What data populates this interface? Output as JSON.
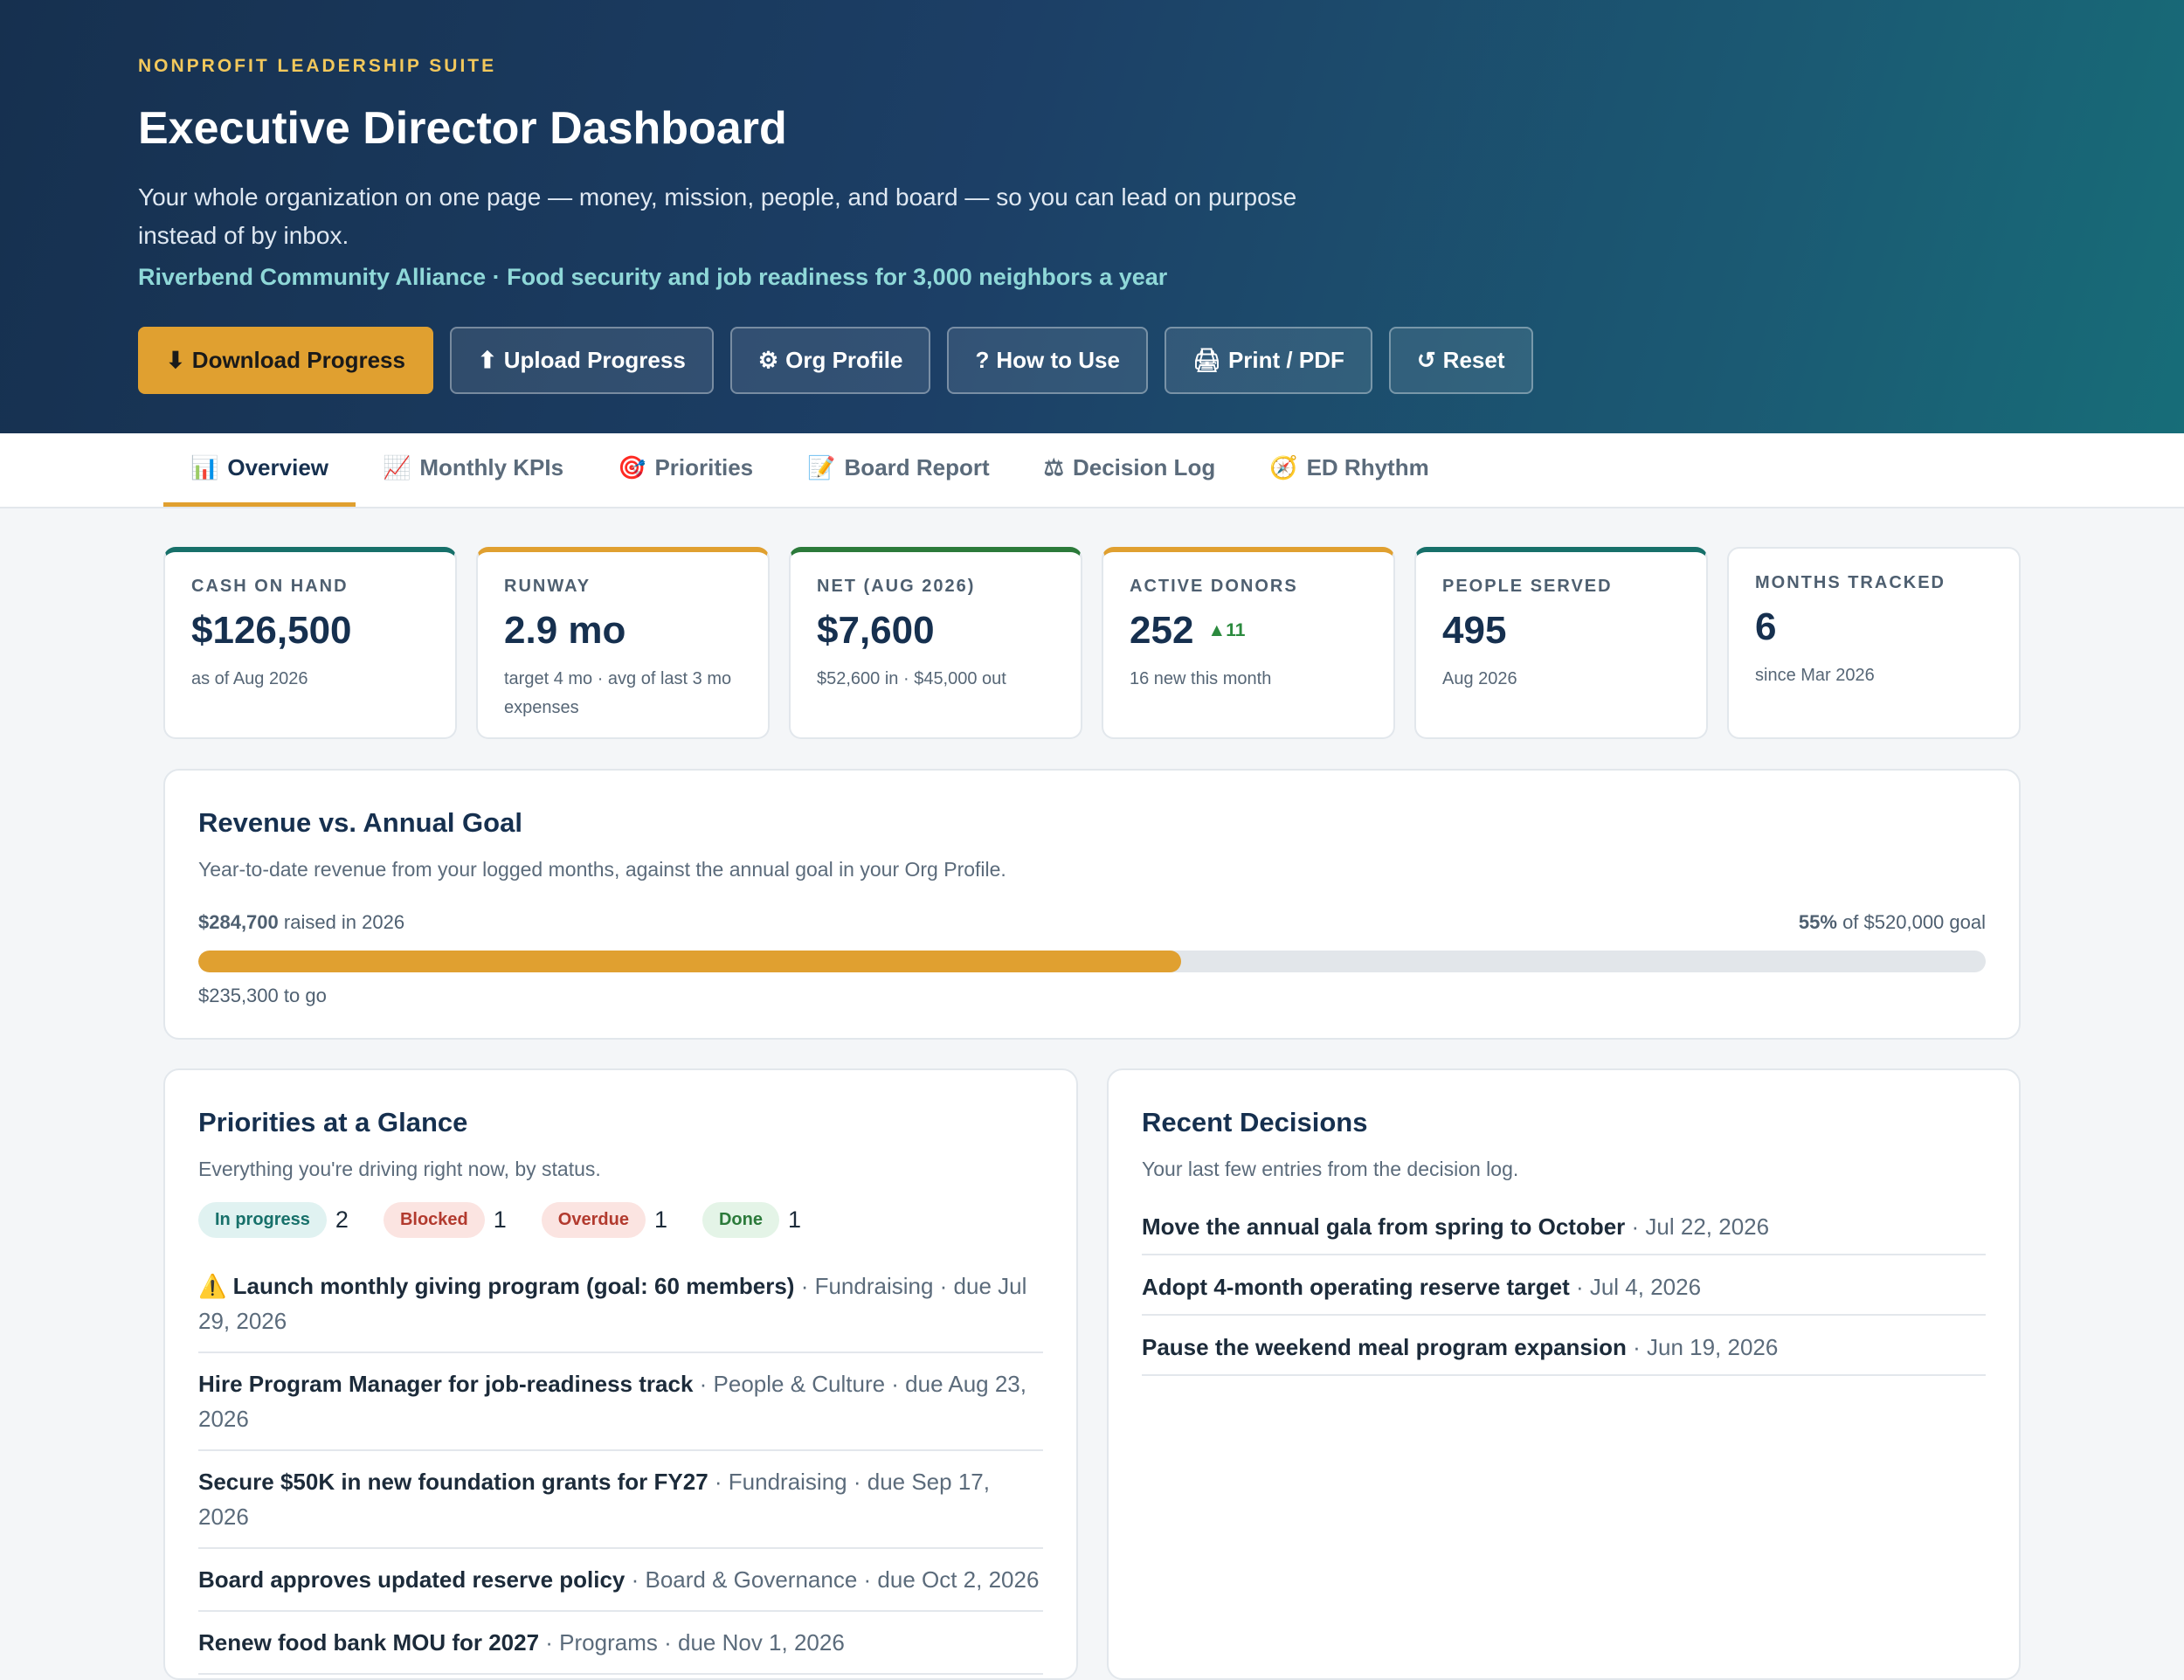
{
  "header": {
    "eyebrow": "NONPROFIT LEADERSHIP SUITE",
    "title": "Executive Director Dashboard",
    "lede": "Your whole organization on one page — money, mission, people, and board — so you can lead on purpose instead of by inbox.",
    "org_line": "Riverbend Community Alliance · Food security and job readiness for 3,000 neighbors a year",
    "buttons": [
      {
        "icon": "⬇",
        "label": "Download Progress"
      },
      {
        "icon": "⬆",
        "label": "Upload Progress"
      },
      {
        "icon": "⚙",
        "label": "Org Profile"
      },
      {
        "icon": "?",
        "label": "How to Use"
      },
      {
        "icon": "🖨",
        "label": "Print / PDF"
      },
      {
        "icon": "↺",
        "label": "Reset"
      }
    ]
  },
  "tabs": [
    {
      "icon": "📊",
      "label": "Overview",
      "active": true
    },
    {
      "icon": "📈",
      "label": "Monthly KPIs"
    },
    {
      "icon": "🎯",
      "label": "Priorities"
    },
    {
      "icon": "📝",
      "label": "Board Report"
    },
    {
      "icon": "⚖",
      "label": "Decision Log"
    },
    {
      "icon": "🧭",
      "label": "ED Rhythm"
    }
  ],
  "kpis": [
    {
      "label": "CASH ON HAND",
      "value": "$126,500",
      "sub": "as of Aug 2026",
      "accent": "#17706a"
    },
    {
      "label": "RUNWAY",
      "value": "2.9 mo",
      "sub": "target 4 mo · avg of last 3 mo expenses",
      "accent": "#e0a030"
    },
    {
      "label": "NET (AUG 2026)",
      "value": "$7,600",
      "sub": "$52,600 in · $45,000 out",
      "accent": "#2b7a3a"
    },
    {
      "label": "ACTIVE DONORS",
      "value": "252",
      "delta": "▲11",
      "sub": "16 new this month",
      "accent": "#e0a030"
    },
    {
      "label": "PEOPLE SERVED",
      "value": "495",
      "sub": "Aug 2026",
      "accent": "#17706a"
    },
    {
      "label": "MONTHS TRACKED",
      "value": "6",
      "sub": "since Mar 2026",
      "accent": ""
    }
  ],
  "goal": {
    "title": "Revenue vs. Annual Goal",
    "desc": "Year-to-date revenue from your logged months, against the annual goal in your Org Profile.",
    "raised": "$284,700",
    "raised_suffix": " raised in 2026",
    "pct": "55%",
    "pct_suffix": " of $520,000 goal",
    "progress": 0.55,
    "to_go": "$235,300 to go"
  },
  "priorities": {
    "title": "Priorities at a Glance",
    "desc": "Everything you're driving right now, by status.",
    "status": [
      {
        "label": "In progress",
        "count": "2",
        "cls": "ip"
      },
      {
        "label": "Blocked",
        "count": "1",
        "cls": "bl"
      },
      {
        "label": "Overdue",
        "count": "1",
        "cls": "od"
      },
      {
        "label": "Done",
        "count": "1",
        "cls": "dn"
      }
    ],
    "items": [
      {
        "title": "⚠️ Launch monthly giving program (goal: 60 members)",
        "meta": " · Fundraising · due Jul 29, 2026"
      },
      {
        "title": "Hire Program Manager for job-readiness track",
        "meta": " · People & Culture · due Aug 23, 2026"
      },
      {
        "title": "Secure $50K in new foundation grants for FY27",
        "meta": " · Fundraising · due Sep 17, 2026"
      },
      {
        "title": "Board approves updated reserve policy",
        "meta": " · Board & Governance · due Oct 2, 2026"
      },
      {
        "title": "Renew food bank MOU for 2027",
        "meta": " · Programs · due Nov 1, 2026"
      }
    ]
  },
  "decisions": {
    "title": "Recent Decisions",
    "desc": "Your last few entries from the decision log.",
    "items": [
      {
        "title": "Move the annual gala from spring to October",
        "meta": " · Jul 22, 2026"
      },
      {
        "title": "Adopt 4-month operating reserve target",
        "meta": " · Jul 4, 2026"
      },
      {
        "title": "Pause the weekend meal program expansion",
        "meta": " · Jun 19, 2026"
      }
    ]
  }
}
